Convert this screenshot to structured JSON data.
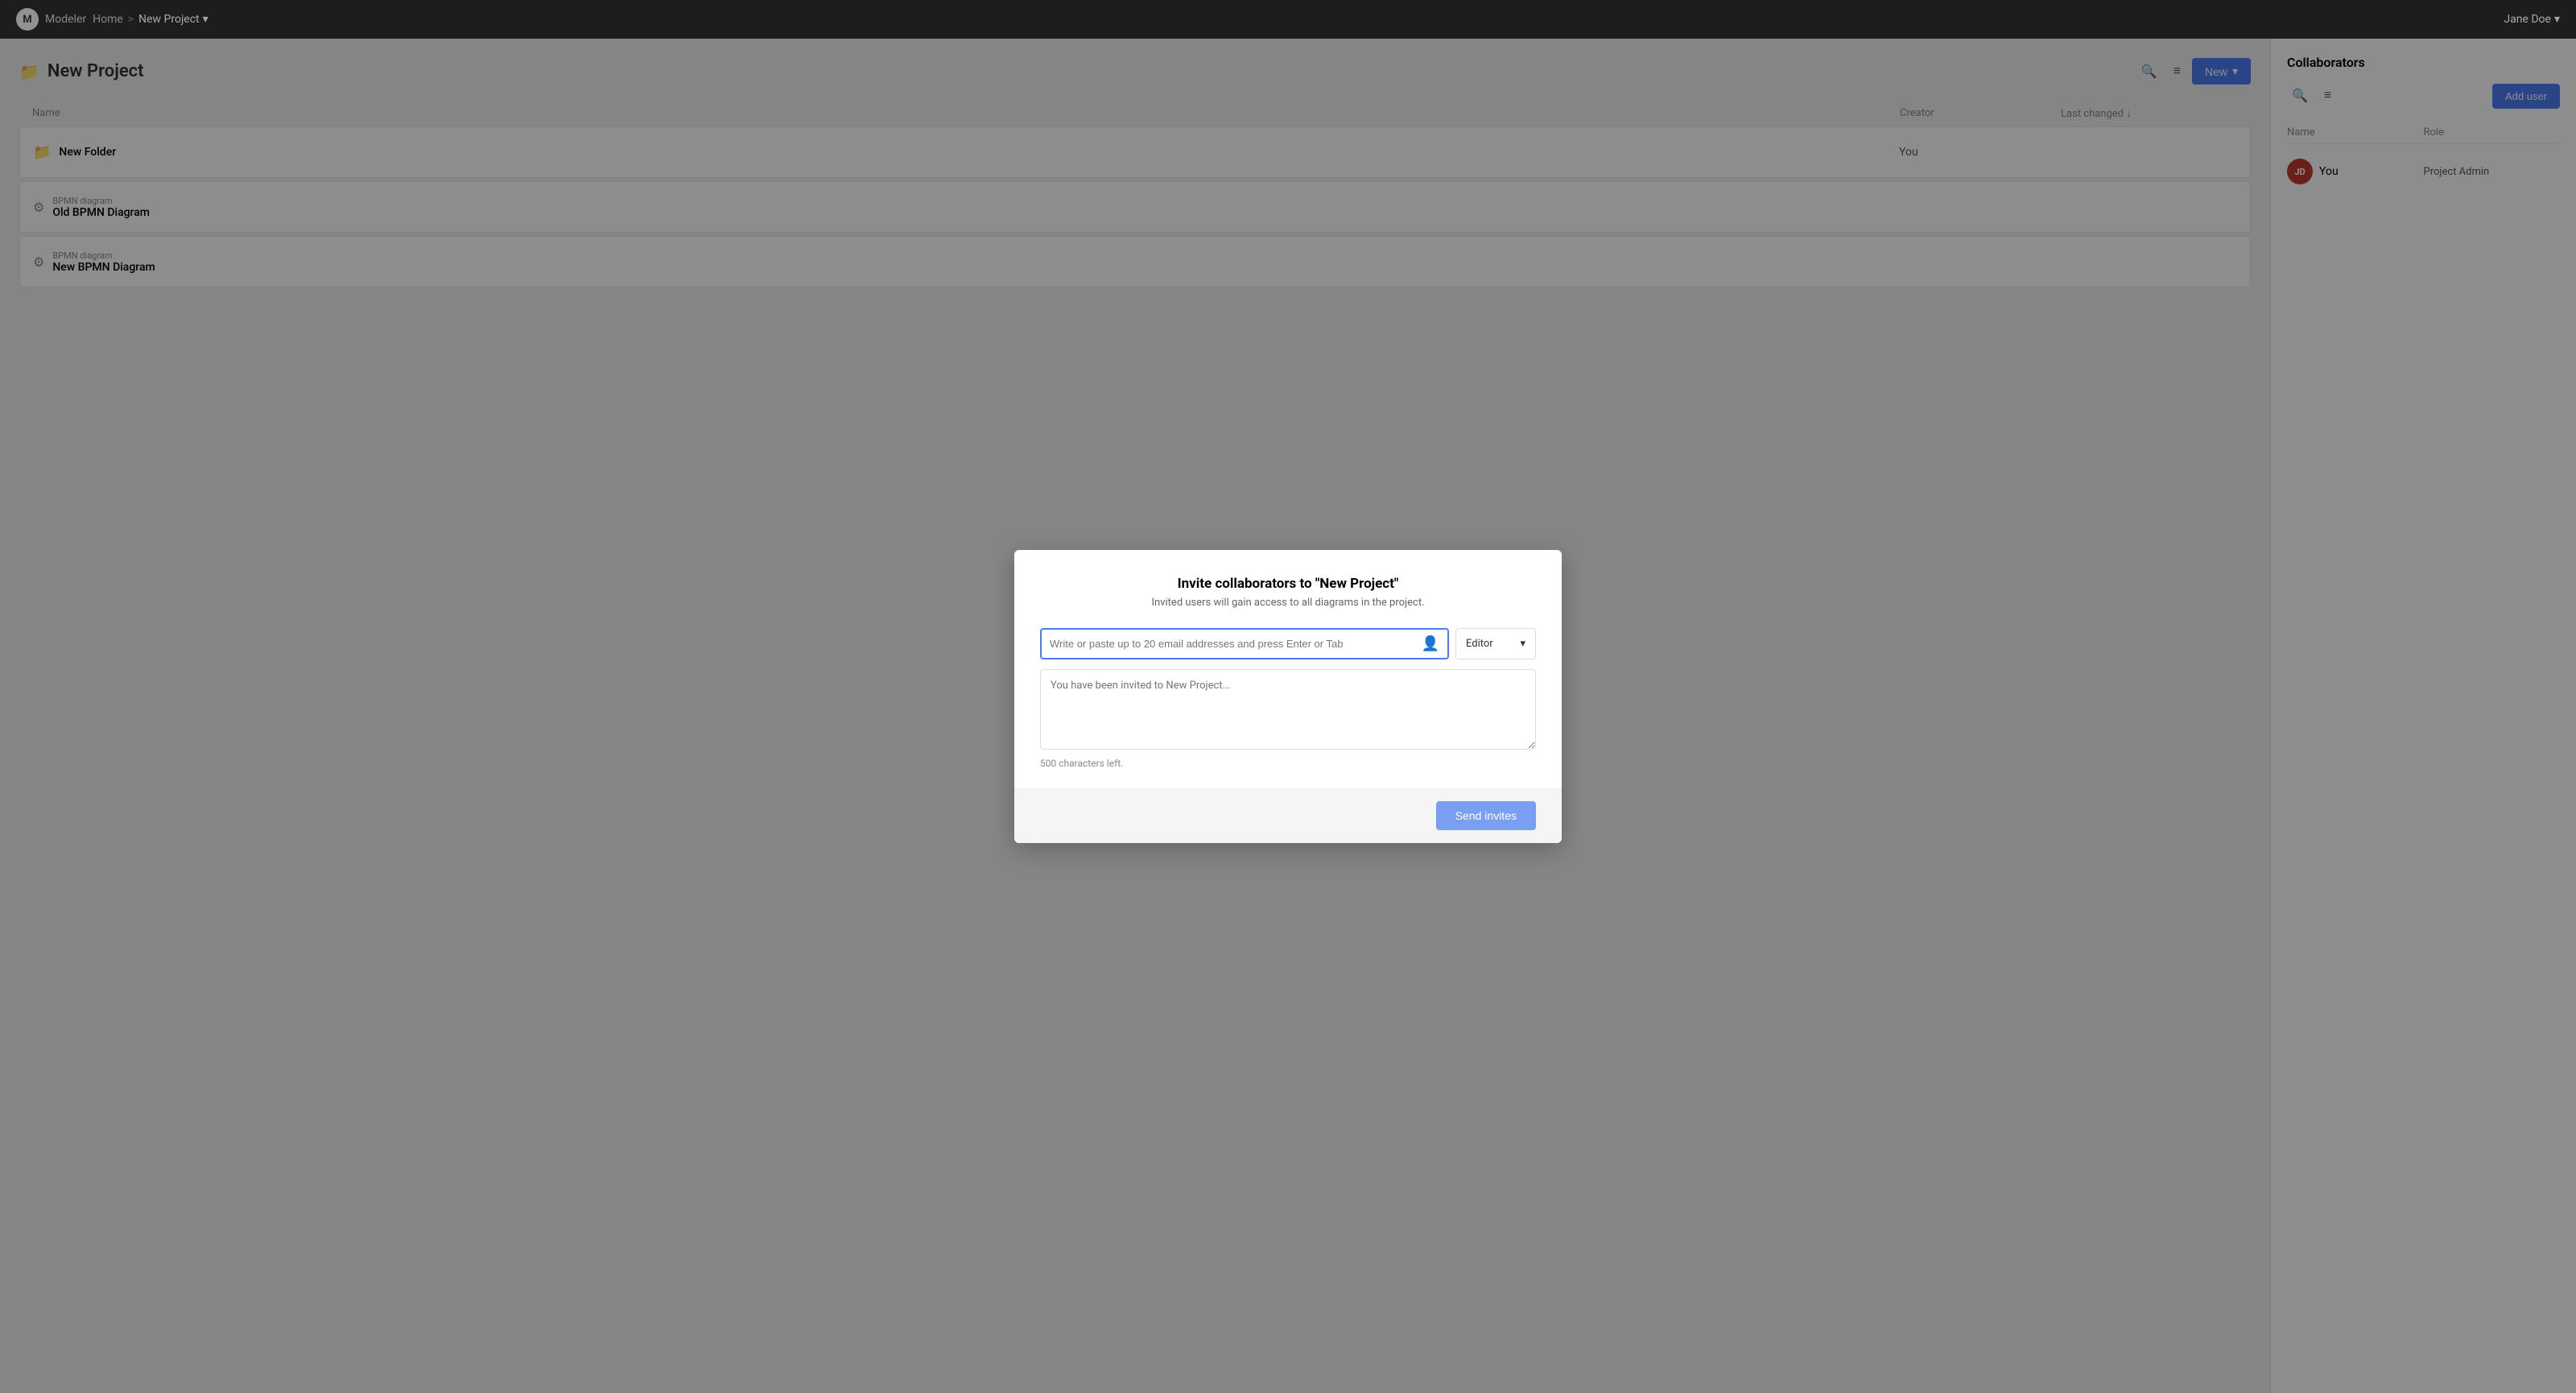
{
  "app": {
    "logo": "M",
    "name": "Modeler"
  },
  "breadcrumb": {
    "home": "Home",
    "separator": ">",
    "current": "New Project",
    "dropdown_icon": "▾"
  },
  "user": {
    "name": "Jane Doe",
    "dropdown_icon": "▾"
  },
  "page": {
    "title": "New Project",
    "icon": "📁"
  },
  "table": {
    "columns": {
      "name": "Name",
      "creator": "Creator",
      "last_changed": "Last changed",
      "sort_icon": "↓"
    },
    "rows": [
      {
        "type": "folder",
        "icon": "folder",
        "sub_label": "",
        "title": "New Folder",
        "creator": "You",
        "last_changed": ""
      },
      {
        "type": "bpmn",
        "icon": "gear",
        "sub_label": "BPMN diagram",
        "title": "Old BPMN Diagram",
        "creator": "",
        "last_changed": ""
      },
      {
        "type": "bpmn",
        "icon": "gear",
        "sub_label": "BPMN diagram",
        "title": "New BPMN Diagram",
        "creator": "",
        "last_changed": ""
      }
    ]
  },
  "header_buttons": {
    "search_icon": "🔍",
    "filter_icon": "≡",
    "new_label": "New",
    "new_dropdown": "▾"
  },
  "collaborators": {
    "title": "Collaborators",
    "add_user_label": "Add user",
    "columns": {
      "name": "Name",
      "role": "Role"
    },
    "users": [
      {
        "initials": "JD",
        "name": "You",
        "role": "Project Admin"
      }
    ]
  },
  "modal": {
    "title": "Invite collaborators to \"New Project\"",
    "subtitle": "Invited users will gain access to all diagrams in the project.",
    "email_placeholder": "Write or paste up to 20 email addresses and press Enter or Tab",
    "email_icon": "👤",
    "role_label": "Editor",
    "role_dropdown": "▾",
    "message_placeholder": "You have been invited to New Project...",
    "char_count": "500 characters left.",
    "send_label": "Send invites"
  }
}
